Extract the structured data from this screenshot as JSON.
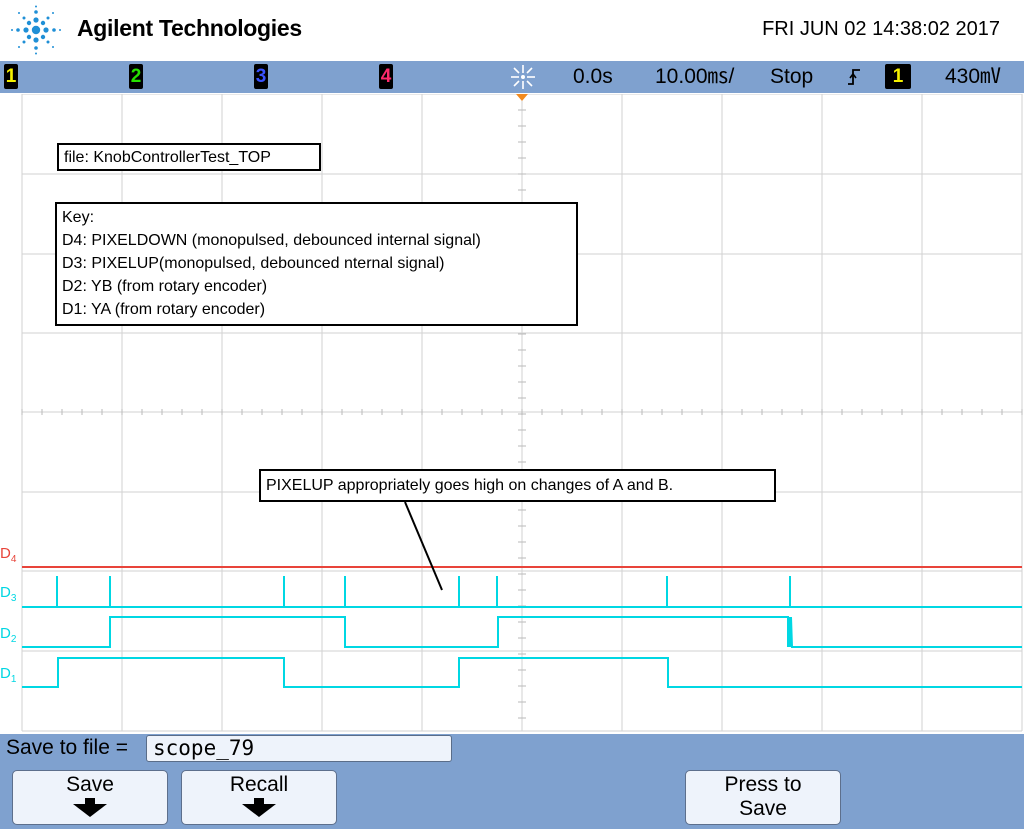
{
  "header": {
    "brand": "Agilent Technologies",
    "datetime": "FRI JUN 02 14:38:02 2017",
    "logo_icon": "agilent-spark-logo-icon"
  },
  "status_bar": {
    "channels": [
      {
        "label": "1",
        "color": "#f5f100"
      },
      {
        "label": "2",
        "color": "#26e000"
      },
      {
        "label": "3",
        "color": "#3a52ff"
      },
      {
        "label": "4",
        "color": "#ff2a6b"
      }
    ],
    "trigger_icon": "trigger-spark-icon",
    "delay": "0.0s",
    "timebase": "10.00㎳/",
    "run_state": "Stop",
    "trigger_edge_icon": "rising-edge-icon",
    "trigger_source": "1",
    "trigger_level": "430㎷"
  },
  "plot": {
    "file_note": "file: KnobControllerTest_TOP",
    "key_lines": [
      "Key:",
      "D4: PIXELDOWN (monopulsed, debounced internal signal)",
      "D3: PIXELUP(monopulsed, debounced nternal signal)",
      "D2: YB (from rotary encoder)",
      "D1: YA (from rotary encoder)"
    ],
    "annotation": "PIXELUP appropriately goes high on changes of A and B.",
    "digital_labels": [
      {
        "name": "D",
        "sub": "4",
        "color": "#e8443a"
      },
      {
        "name": "D",
        "sub": "3",
        "color": "#00d7e3"
      },
      {
        "name": "D",
        "sub": "2",
        "color": "#00d7e3"
      },
      {
        "name": "D",
        "sub": "1",
        "color": "#00d7e3"
      }
    ]
  },
  "bottom": {
    "save_to_file_label": "Save to file =",
    "filename": "scope_79",
    "softkeys": {
      "save": "Save",
      "recall": "Recall",
      "press_to_save_line1": "Press to",
      "press_to_save_line2": "Save"
    }
  }
}
